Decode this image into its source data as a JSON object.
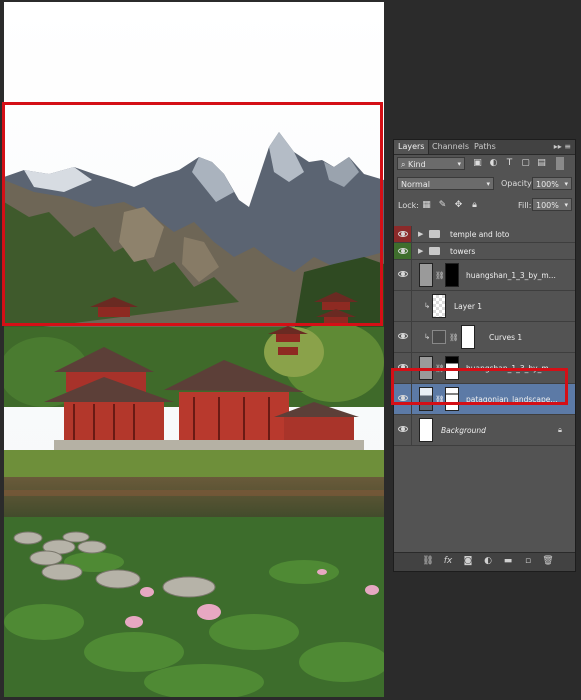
{
  "panel": {
    "tabs": [
      "Layers",
      "Channels",
      "Paths"
    ],
    "kind_filter": "Kind",
    "blend_mode": "Normal",
    "opacity_label": "Opacity:",
    "opacity_value": "100%",
    "lock_label": "Lock:",
    "fill_label": "Fill:",
    "fill_value": "100%"
  },
  "layers": [
    {
      "name": "temple and loto",
      "type": "group",
      "color": "#8b2a2a",
      "visible": true
    },
    {
      "name": "towers",
      "type": "group",
      "color": "#3f6e2d",
      "visible": true
    },
    {
      "name": "huangshan_1_3_by_m...",
      "type": "layer-mask",
      "visible": true
    },
    {
      "name": "Layer 1",
      "type": "clipped-layer",
      "visible": false
    },
    {
      "name": "Curves 1",
      "type": "adjustment",
      "visible": true
    },
    {
      "name": "huangshan_1_3_by_m...",
      "type": "layer-mask",
      "visible": true
    },
    {
      "name": "patagonian_landscape...",
      "type": "layer-mask",
      "visible": true,
      "selected": true
    },
    {
      "name": "Background",
      "type": "background",
      "visible": true,
      "locked": true
    }
  ],
  "colors": {
    "highlight": "#d40f16",
    "selected_layer": "#5c7aa6",
    "panel_bg": "#535353"
  }
}
